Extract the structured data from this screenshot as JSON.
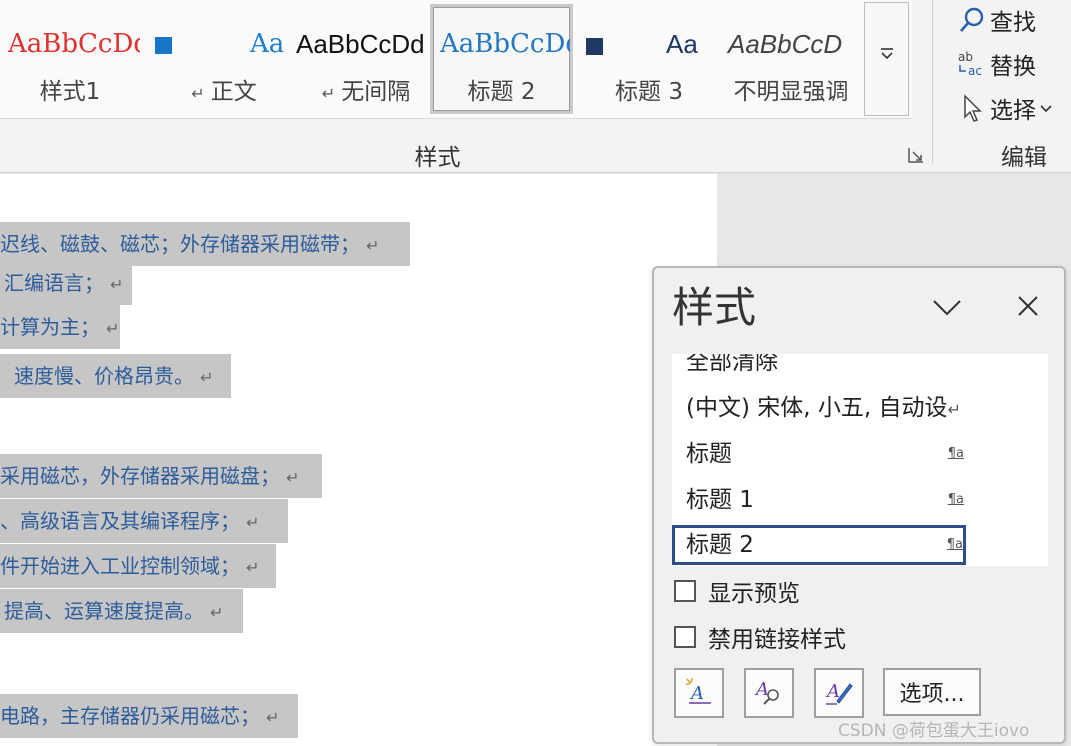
{
  "ribbon": {
    "styles_gallery": [
      {
        "preview": "AaBbCcDd",
        "name": "样式1",
        "preview_color": "#e0312e",
        "has_square": false
      },
      {
        "preview": "AaI",
        "name": "正文",
        "preview_color": "#1f7fcf",
        "has_square": true,
        "square_color": "#1876c7",
        "para_mark": "↵"
      },
      {
        "preview": "AaBbCcDd",
        "name": "无间隔",
        "preview_color": "#111111",
        "has_square": false,
        "para_mark": "↵"
      },
      {
        "preview": "AaBbCcDd",
        "name": "标题 2",
        "preview_color": "#2477c2",
        "has_square": false,
        "selected": true
      },
      {
        "preview": "Aa",
        "name": "标题 3",
        "preview_color": "#1f3864",
        "has_square": true,
        "square_color": "#1f3864"
      },
      {
        "preview": "AaBbCcD",
        "name": "不明显强调",
        "preview_color": "#444444",
        "has_square": false,
        "italic": true
      }
    ],
    "group_label_styles": "样式",
    "editing": {
      "find_label": "查找",
      "replace_label": "替换",
      "select_label": "选择",
      "group_label": "编辑"
    }
  },
  "document": {
    "lines": [
      {
        "text": "迟线、磁鼓、磁芯；外存储器采用磁带；"
      },
      {
        "text": "汇编语言；"
      },
      {
        "text": "计算为主；"
      },
      {
        "text": "速度慢、价格昂贵。"
      },
      {
        "text": "采用磁芯，外存储器采用磁盘；"
      },
      {
        "text": "、高级语言及其编译程序；"
      },
      {
        "text": "件开始进入工业控制领域；"
      },
      {
        "text": "提高、运算速度提高。"
      },
      {
        "text": "电路，主存储器仍采用磁芯；"
      }
    ],
    "para_mark": "↵"
  },
  "styles_pane": {
    "title": "样式",
    "items": [
      {
        "label": "全部清除",
        "kind": ""
      },
      {
        "label": "(中文) 宋体, 小五, 自动设",
        "kind": "",
        "para_mark": "↵"
      },
      {
        "label": "标题",
        "kind": "¶a"
      },
      {
        "label": "标题 1",
        "kind": "¶a"
      },
      {
        "label": "标题 2",
        "kind": "¶a",
        "active": true
      }
    ],
    "show_preview_label": "显示预览",
    "disable_linked_label": "禁用链接样式",
    "show_preview_checked": false,
    "disable_linked_checked": false,
    "options_label": "选项..."
  },
  "watermark": "CSDN @荷包蛋大王iovo"
}
